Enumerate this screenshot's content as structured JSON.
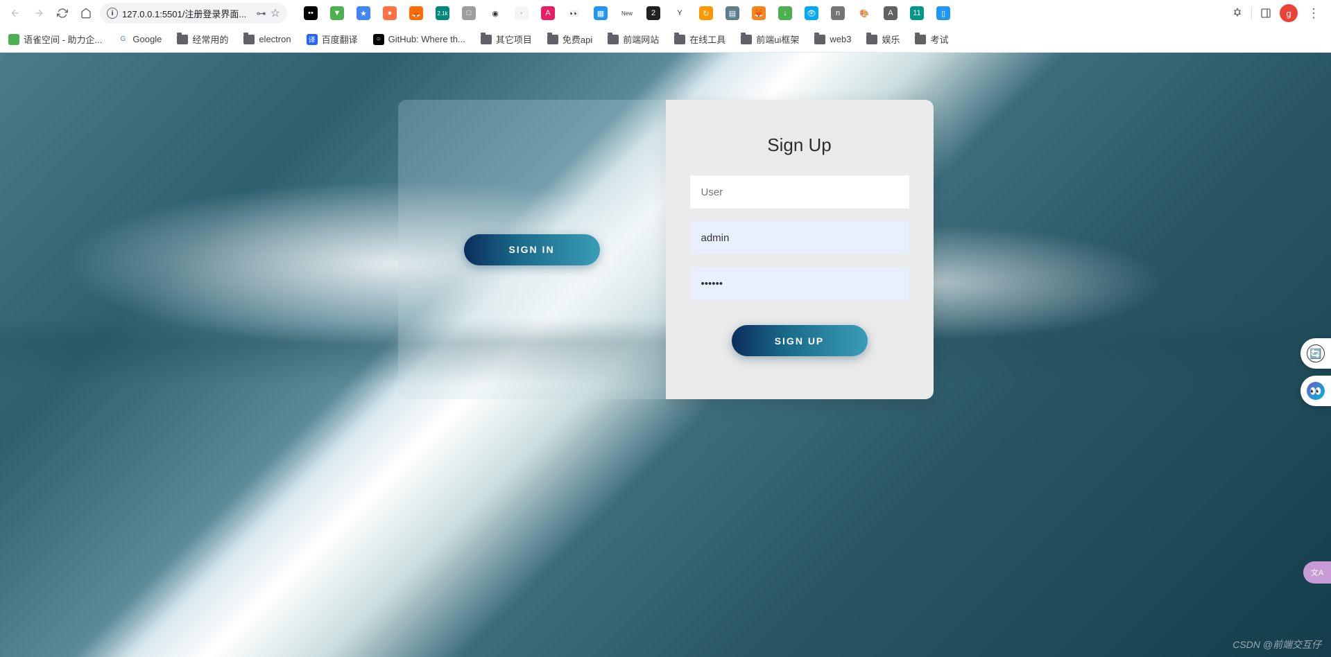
{
  "browser": {
    "url": "127.0.0.1:5501/注册登录界面...",
    "profile_initial": "g",
    "extensions": [
      {
        "name": "ext-black-dots",
        "bg": "#000",
        "glyph": "••"
      },
      {
        "name": "ext-shield-green",
        "bg": "#4caf50",
        "glyph": "▼"
      },
      {
        "name": "ext-star-blue",
        "bg": "#4285f4",
        "glyph": "★"
      },
      {
        "name": "ext-orange",
        "bg": "#ff7043",
        "glyph": "●"
      },
      {
        "name": "ext-fox",
        "bg": "#ff6d00",
        "glyph": "🦊"
      },
      {
        "name": "ext-cart",
        "bg": "#00897b",
        "glyph": "2.1k"
      },
      {
        "name": "ext-gray",
        "bg": "#9e9e9e",
        "glyph": "□"
      },
      {
        "name": "ext-circles",
        "bg": "#fff",
        "glyph": "◉"
      },
      {
        "name": "ext-faint",
        "bg": "#f5f5f5",
        "glyph": "·"
      },
      {
        "name": "ext-pink",
        "bg": "#e91e63",
        "glyph": "A"
      },
      {
        "name": "ext-eyes",
        "bg": "#fff",
        "glyph": "👀"
      },
      {
        "name": "ext-blue-sq",
        "bg": "#2196f3",
        "glyph": "▦"
      },
      {
        "name": "ext-new",
        "bg": "#fff",
        "glyph": "New"
      },
      {
        "name": "ext-dark",
        "bg": "#212121",
        "glyph": "2"
      },
      {
        "name": "ext-y",
        "bg": "#fff",
        "glyph": "Y"
      },
      {
        "name": "ext-refresh",
        "bg": "#ff9800",
        "glyph": "↻"
      },
      {
        "name": "ext-doc",
        "bg": "#607d8b",
        "glyph": "▤"
      },
      {
        "name": "ext-metamask",
        "bg": "#f6851b",
        "glyph": "🦊"
      },
      {
        "name": "ext-download",
        "bg": "#4caf50",
        "glyph": "↓"
      },
      {
        "name": "ext-eye",
        "bg": "#03a9f4",
        "glyph": "👁"
      },
      {
        "name": "ext-n",
        "bg": "#757575",
        "glyph": "n"
      },
      {
        "name": "ext-rainbow",
        "bg": "#fff",
        "glyph": "🎨"
      },
      {
        "name": "ext-a",
        "bg": "#616161",
        "glyph": "A"
      },
      {
        "name": "ext-teal11",
        "bg": "#009688",
        "glyph": "11"
      },
      {
        "name": "ext-blue",
        "bg": "#2196f3",
        "glyph": "▯"
      }
    ]
  },
  "bookmarks": [
    {
      "type": "icon",
      "label": "语雀空间 - 助力企...",
      "bg": "#4caf50"
    },
    {
      "type": "icon",
      "label": "Google",
      "bg": "#fff",
      "glyph": "G"
    },
    {
      "type": "folder",
      "label": "经常用的"
    },
    {
      "type": "folder",
      "label": "electron"
    },
    {
      "type": "icon",
      "label": "百度翻译",
      "bg": "#2962ff",
      "glyph": "译"
    },
    {
      "type": "icon",
      "label": "GitHub: Where th...",
      "bg": "#000",
      "glyph": "○"
    },
    {
      "type": "folder",
      "label": "其它项目"
    },
    {
      "type": "folder",
      "label": "免费api"
    },
    {
      "type": "folder",
      "label": "前端网站"
    },
    {
      "type": "folder",
      "label": "在线工具"
    },
    {
      "type": "folder",
      "label": "前端ui框架"
    },
    {
      "type": "folder",
      "label": "web3"
    },
    {
      "type": "folder",
      "label": "娱乐"
    },
    {
      "type": "folder",
      "label": "考试"
    }
  ],
  "left_panel": {
    "button_label": "SIGN IN"
  },
  "right_panel": {
    "title": "Sign Up",
    "user_placeholder": "User",
    "username_value": "admin",
    "password_value": "••••••",
    "button_label": "SIGN UP"
  },
  "floating": {
    "translate_glyph": "🔄",
    "assistant_glyph": "👀",
    "purple_glyph": "文A"
  },
  "watermark": "CSDN @前端交互仔"
}
